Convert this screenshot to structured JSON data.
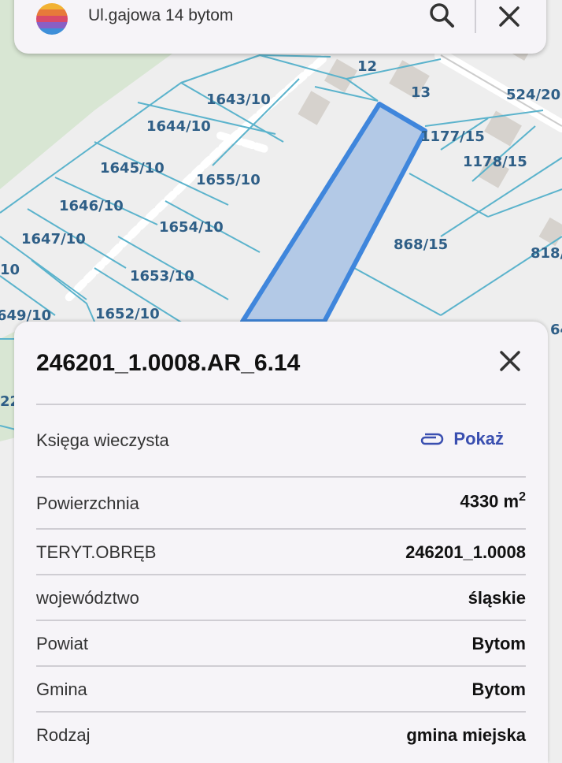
{
  "search": {
    "query": "Ul.gajowa 14 bytom"
  },
  "map": {
    "parcel_labels": [
      "12",
      "13",
      "524/20",
      "1643/10",
      "1644/10",
      "1177/15",
      "1178/15",
      "1645/10",
      "1655/10",
      "1646/10",
      "1654/10",
      "868/15",
      "1647/10",
      "818/",
      "10",
      "1653/10",
      "649/10",
      "1652/10",
      "64",
      "22"
    ],
    "colors": {
      "parcel_fill": "#b3c9e6",
      "parcel_stroke": "#3f86dc",
      "boundary": "#5bb3cc",
      "label": "#2f5f87",
      "forest": "#d8e6d3"
    }
  },
  "panel": {
    "title": "246201_1.0008.AR_6.14",
    "ksiega_label": "Księga wieczysta",
    "ksiega_link": "Pokaż",
    "rows": [
      {
        "label": "Powierzchnia",
        "value": "4330 m",
        "sup": "2"
      },
      {
        "label": "TERYT.OBRĘB",
        "value": "246201_1.0008"
      },
      {
        "label": "województwo",
        "value": "śląskie"
      },
      {
        "label": "Powiat",
        "value": "Bytom"
      },
      {
        "label": "Gmina",
        "value": "Bytom"
      },
      {
        "label": "Rodzaj",
        "value": "gmina miejska"
      }
    ]
  }
}
